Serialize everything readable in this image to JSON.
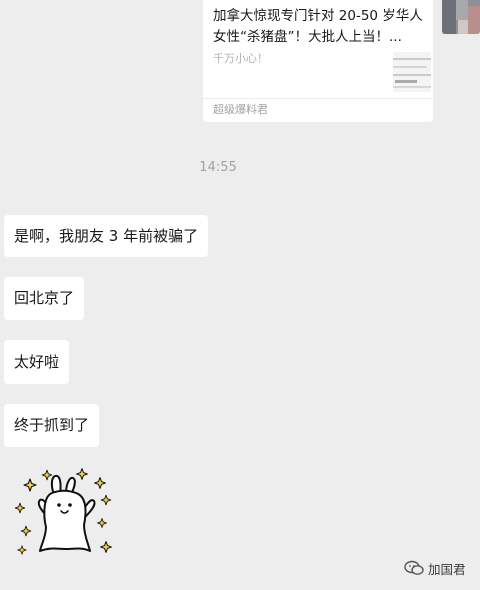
{
  "shared_card": {
    "title": "加拿大惊现专门针对 20-50 岁华人女性“杀猪盘”！大批人上当！...",
    "description": "千万小心！",
    "source": "超级爆料君"
  },
  "timestamp": "14:55",
  "messages": [
    {
      "text": "是啊，我朋友 3 年前被骗了"
    },
    {
      "text": "回北京了"
    },
    {
      "text": "太好啦"
    },
    {
      "text": "终于抓到了"
    }
  ],
  "sticker": {
    "icon": "bunny-sparkle-sticker"
  },
  "watermark": {
    "text": "加国君",
    "icon": "wechat-official-account-icon"
  },
  "colors": {
    "background": "#ededed",
    "bubble": "#ffffff",
    "time_text": "#a2a2a2",
    "sparkle_yellow": "#f6d23c"
  }
}
